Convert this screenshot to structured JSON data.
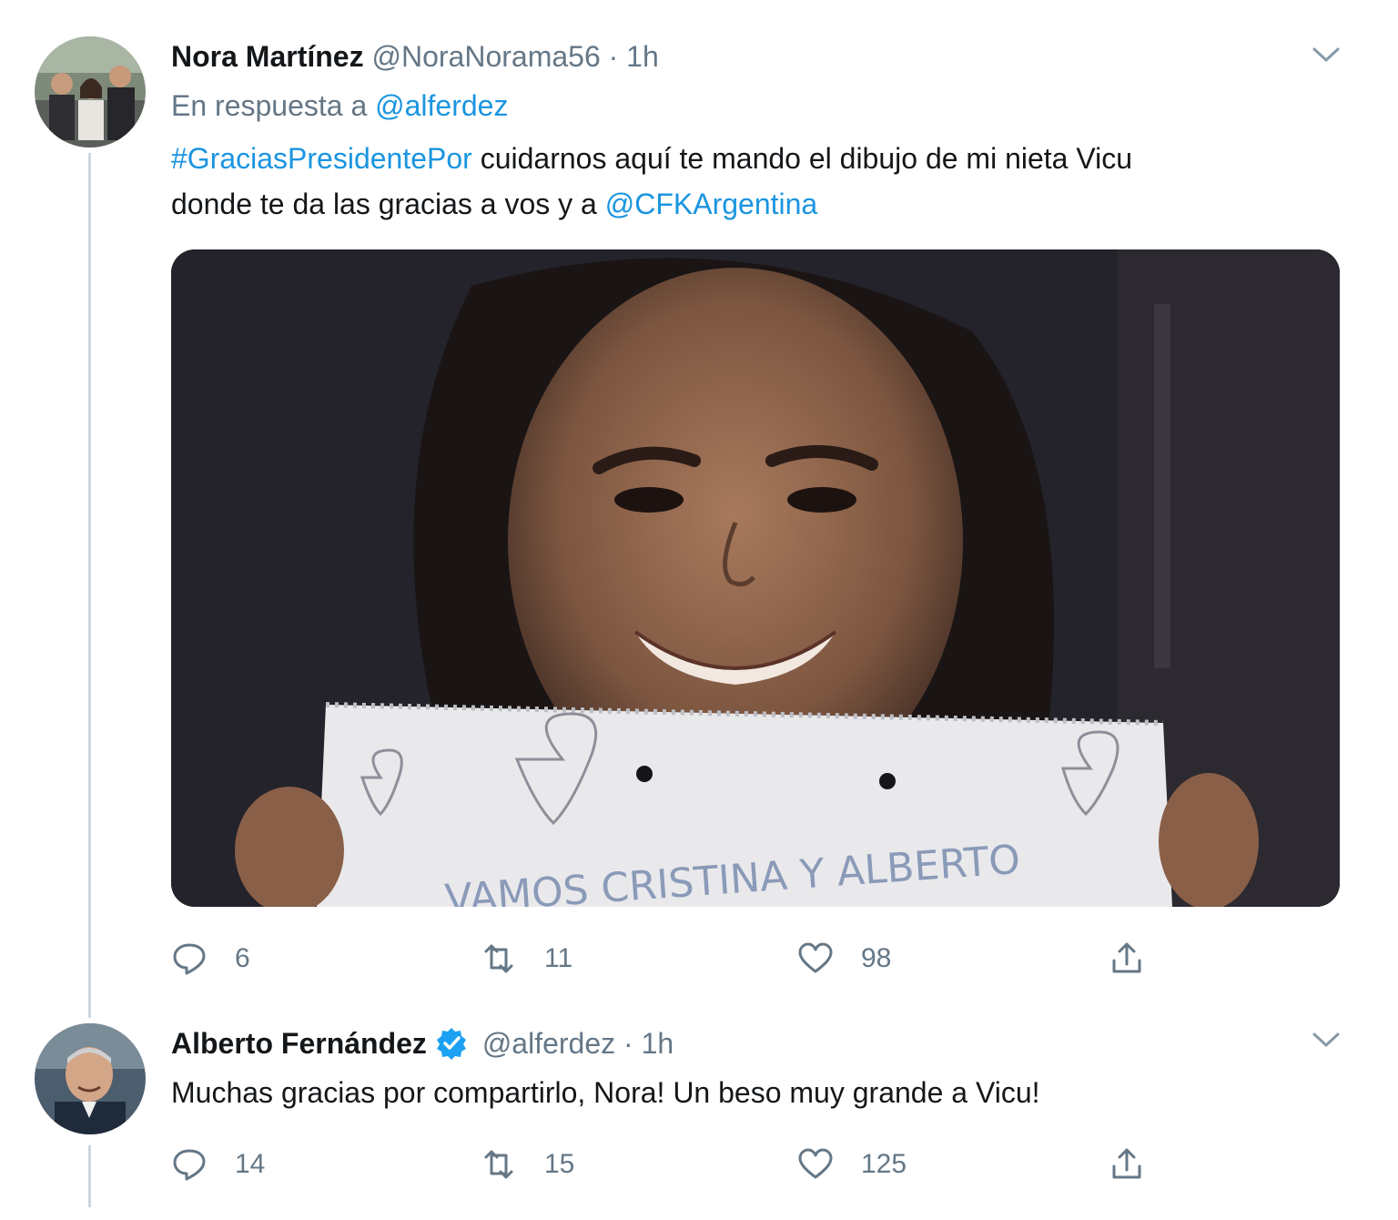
{
  "tweet1": {
    "name": "Nora Martínez",
    "handle": "@NoraNorama56",
    "separator": "·",
    "time": "1h",
    "reply_prefix": "En respuesta a",
    "reply_to": "@alferdez",
    "hashtag": "#GraciasPresidentePor",
    "text_line1_rest": " cuidarnos aquí te mando el dibujo de mi nieta Vicu",
    "text_line2_start": "donde te da las gracias a vos y a ",
    "mention": "@CFKArgentina",
    "image_note": "VAMOS CRISTINA Y ALBERTO",
    "replies": "6",
    "retweets": "11",
    "likes": "98"
  },
  "tweet2": {
    "name": "Alberto Fernández",
    "handle": "@alferdez",
    "separator": "·",
    "time": "1h",
    "text": "Muchas gracias por compartirlo, Nora! Un beso muy grande a Vicu!",
    "replies": "14",
    "retweets": "15",
    "likes": "125"
  },
  "colors": {
    "link": "#1b95e0",
    "secondary_text": "#657786",
    "primary_text": "#14171a",
    "verified": "#1da1f2",
    "thread_line": "#ccd6dd"
  },
  "icons": [
    "reply-icon",
    "retweet-icon",
    "like-icon",
    "share-icon",
    "chevron-down-icon",
    "verified-badge-icon"
  ]
}
